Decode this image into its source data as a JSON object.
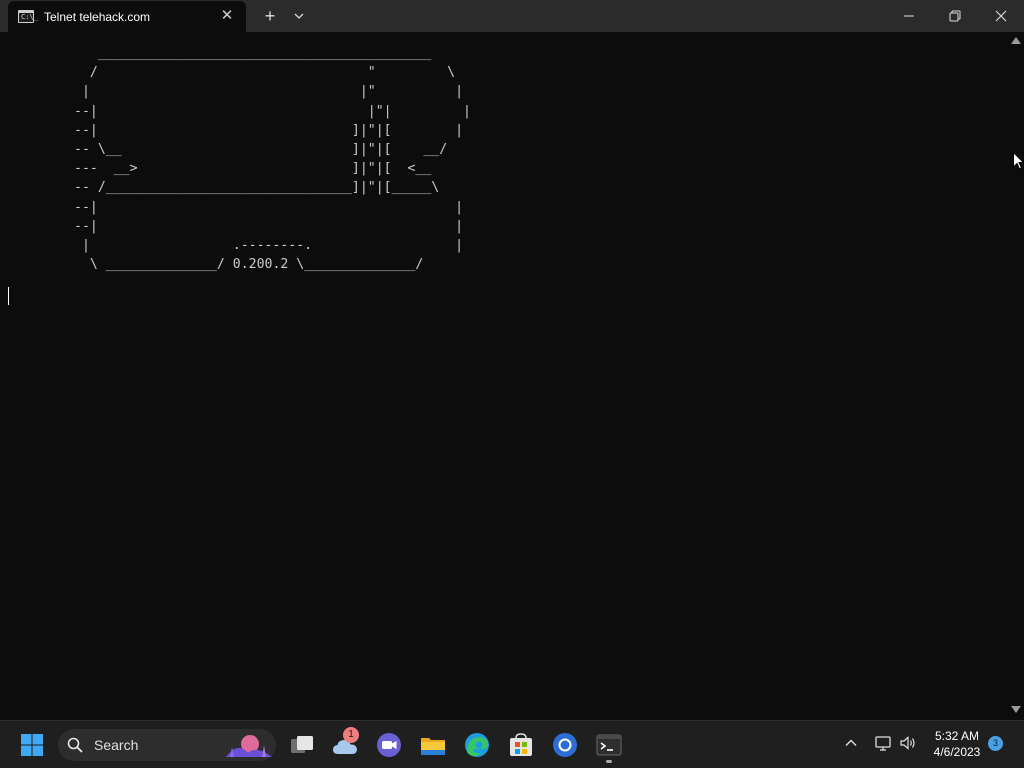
{
  "window": {
    "tab_title": "Telnet telehack.com",
    "tab_close": "✕",
    "new_tab": "+",
    "tab_icon_glyph": "C:\\_"
  },
  "terminal": {
    "ascii_art": "   __________________________________________\n  /                                  \"         \\\n |                                  |\"          |\n--|                                  |\"|         |\n--|                                ]|\"|[        |\n-- \\__                             ]|\"|[    __/\n---  __>                           ]|\"|[  <__\n-- /_______________________________]|\"|[_____\\\n--|                                             |\n--|                                             |\n |                  .--------.                  |\n  \\ ______________/ 0.200.2 \\______________/"
  },
  "taskbar": {
    "search_label": "Search",
    "chat_badge": "1",
    "clock_time": "5:32 AM",
    "clock_date": "4/6/2023",
    "notification_count": "3"
  },
  "colors": {
    "terminal_bg": "#0c0c0c",
    "titlebar_bg": "#2b2b2b",
    "taskbar_bg": "#1f1f1f",
    "text": "#cccccc"
  }
}
